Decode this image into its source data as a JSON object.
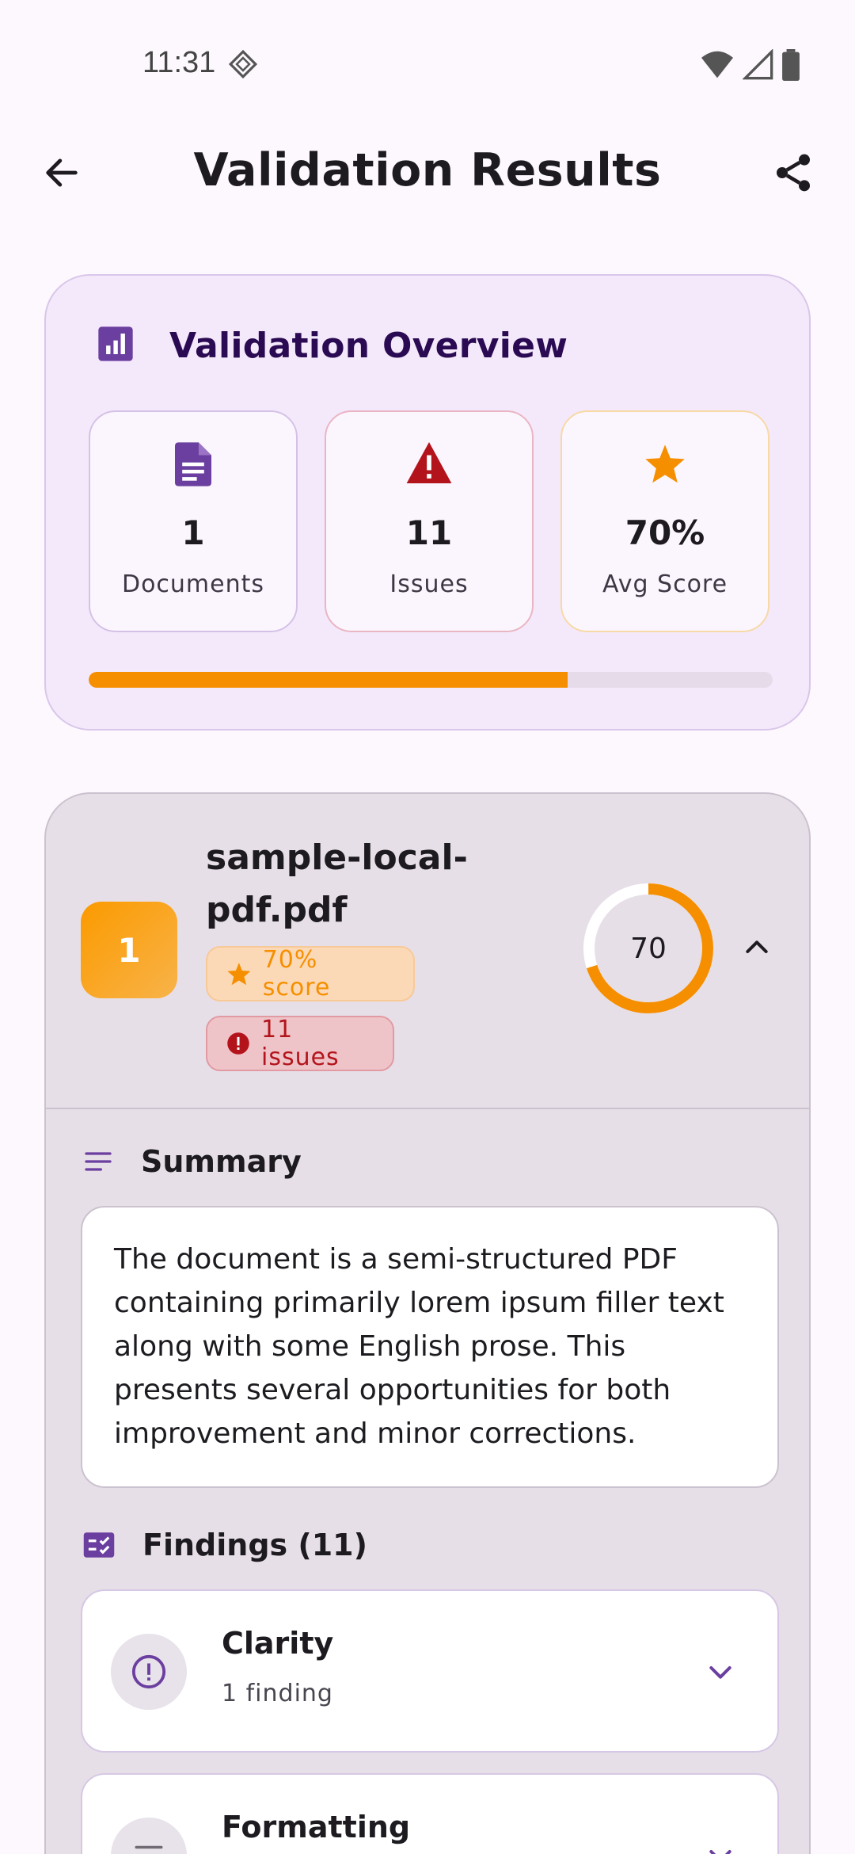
{
  "status_bar": {
    "time": "11:31"
  },
  "app_bar": {
    "title": "Validation Results"
  },
  "overview": {
    "title": "Validation Overview",
    "stats": [
      {
        "value": "1",
        "label": "Documents",
        "icon": "document-icon",
        "color": "#6b3fa0"
      },
      {
        "value": "11",
        "label": "Issues",
        "icon": "warning-icon",
        "color": "#b3141c"
      },
      {
        "value": "70%",
        "label": "Avg Score",
        "icon": "star-icon",
        "color": "#f68f00"
      }
    ],
    "progress_fraction": 0.7,
    "progress_color": "#f68f00"
  },
  "document": {
    "index": "1",
    "name": "sample-local-pdf.pdf",
    "score_badge": "70% score",
    "issues_badge": "11 issues",
    "score": "70",
    "score_fraction": 0.7,
    "summary_title": "Summary",
    "summary_text": "The document is a semi-structured PDF containing primarily lorem ipsum filler text along with some English prose. This presents several opportunities for both improvement and minor corrections.",
    "findings_title": "Findings (11)",
    "findings": [
      {
        "title": "Clarity",
        "subtitle": "1 finding",
        "icon": "info-circle-icon"
      },
      {
        "title": "Formatting",
        "subtitle": "",
        "icon": "format-lines-icon"
      }
    ]
  },
  "colors": {
    "accent": "#6b3fa0",
    "orange": "#f68f00",
    "error": "#b3141c"
  }
}
